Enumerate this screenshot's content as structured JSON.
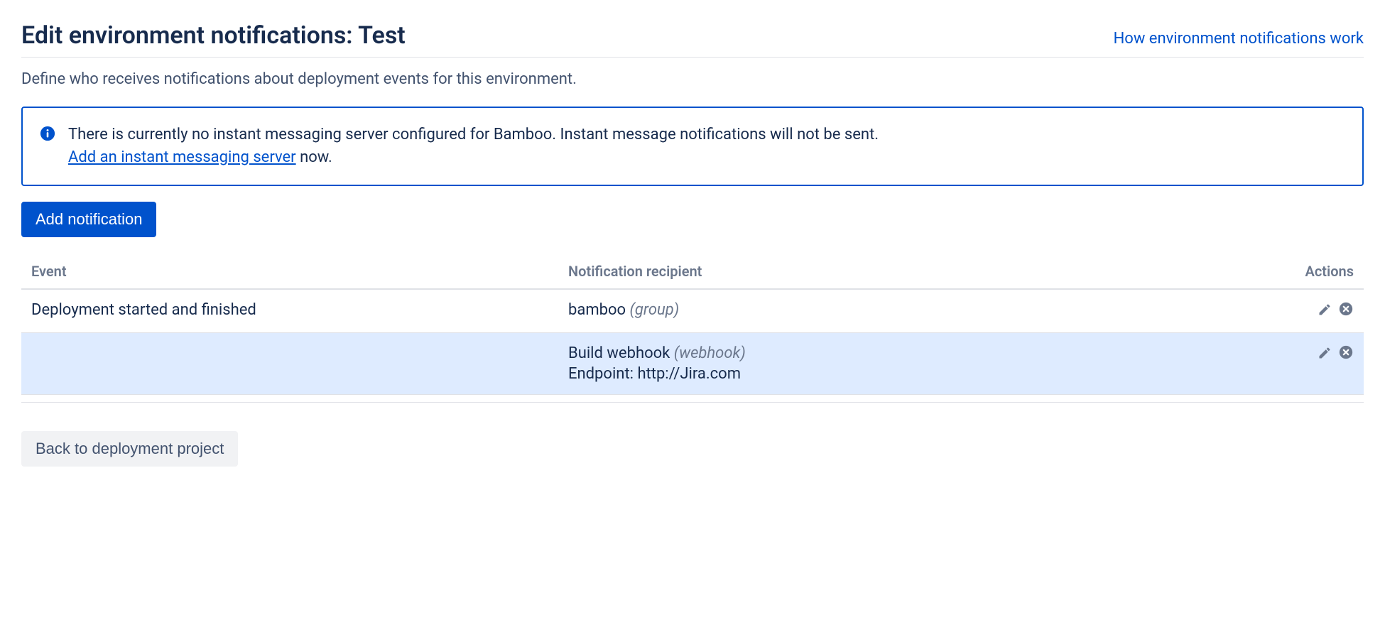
{
  "header": {
    "title": "Edit environment notifications: Test",
    "help_link": "How environment notifications work"
  },
  "description": "Define who receives notifications about deployment events for this environment.",
  "info_panel": {
    "message": "There is currently no instant messaging server configured for Bamboo. Instant message notifications will not be sent.",
    "link_text": "Add an instant messaging server",
    "after_link": " now."
  },
  "buttons": {
    "add_notification": "Add notification",
    "back": "Back to deployment project"
  },
  "table": {
    "columns": {
      "event": "Event",
      "recipient": "Notification recipient",
      "actions": "Actions"
    },
    "rows": [
      {
        "event": "Deployment started and finished",
        "recipient_name": "bamboo",
        "recipient_type": "(group)",
        "extra": ""
      },
      {
        "event": "",
        "recipient_name": "Build webhook",
        "recipient_type": "(webhook)",
        "extra": "Endpoint: http://Jira.com"
      }
    ]
  }
}
